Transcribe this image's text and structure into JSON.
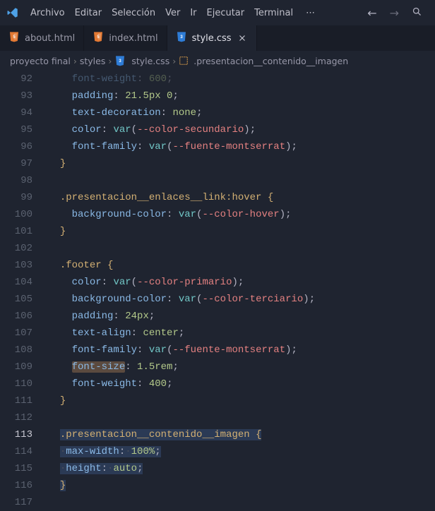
{
  "menu": {
    "items": [
      "Archivo",
      "Editar",
      "Selección",
      "Ver",
      "Ir",
      "Ejecutar",
      "Terminal"
    ],
    "overflow": "⋯"
  },
  "titlebar_nav": {
    "back": "←",
    "forward": "→",
    "search": "search"
  },
  "tabs": [
    {
      "icon": "html",
      "label": "about.html",
      "active": false
    },
    {
      "icon": "html",
      "label": "index.html",
      "active": false
    },
    {
      "icon": "css",
      "label": "style.css",
      "active": true
    }
  ],
  "breadcrumb": {
    "parts": [
      "proyecto final",
      "styles",
      "style.css",
      ".presentacion__contenido__imagen"
    ],
    "separator": "›"
  },
  "lines": [
    {
      "n": 92,
      "indent": 2,
      "segs": [
        {
          "t": "font-weight",
          "c": "prop"
        },
        {
          "t": ": ",
          "c": "punc"
        },
        {
          "t": "600",
          "c": "num"
        },
        {
          "t": ";",
          "c": "punc"
        }
      ],
      "faded": true
    },
    {
      "n": 93,
      "indent": 2,
      "segs": [
        {
          "t": "padding",
          "c": "prop"
        },
        {
          "t": ": ",
          "c": "punc"
        },
        {
          "t": "21.5px 0",
          "c": "num"
        },
        {
          "t": ";",
          "c": "punc"
        }
      ]
    },
    {
      "n": 94,
      "indent": 2,
      "segs": [
        {
          "t": "text-decoration",
          "c": "prop"
        },
        {
          "t": ": ",
          "c": "punc"
        },
        {
          "t": "none",
          "c": "num"
        },
        {
          "t": ";",
          "c": "punc"
        }
      ]
    },
    {
      "n": 95,
      "indent": 2,
      "segs": [
        {
          "t": "color",
          "c": "prop"
        },
        {
          "t": ": ",
          "c": "punc"
        },
        {
          "t": "var",
          "c": "fn"
        },
        {
          "t": "(",
          "c": "punc"
        },
        {
          "t": "--color-secundario",
          "c": "var"
        },
        {
          "t": ")",
          "c": "punc"
        },
        {
          "t": ";",
          "c": "punc"
        }
      ]
    },
    {
      "n": 96,
      "indent": 2,
      "segs": [
        {
          "t": "font-family",
          "c": "prop"
        },
        {
          "t": ": ",
          "c": "punc"
        },
        {
          "t": "var",
          "c": "fn"
        },
        {
          "t": "(",
          "c": "punc"
        },
        {
          "t": "--fuente-montserrat",
          "c": "var"
        },
        {
          "t": ")",
          "c": "punc"
        },
        {
          "t": ";",
          "c": "punc"
        }
      ]
    },
    {
      "n": 97,
      "indent": 1,
      "segs": [
        {
          "t": "}",
          "c": "brace"
        }
      ]
    },
    {
      "n": 98,
      "indent": 0,
      "segs": []
    },
    {
      "n": 99,
      "indent": 1,
      "segs": [
        {
          "t": ".presentacion__enlaces__link:hover ",
          "c": "sel"
        },
        {
          "t": "{",
          "c": "brace"
        }
      ]
    },
    {
      "n": 100,
      "indent": 2,
      "segs": [
        {
          "t": "background-color",
          "c": "prop"
        },
        {
          "t": ": ",
          "c": "punc"
        },
        {
          "t": "var",
          "c": "fn"
        },
        {
          "t": "(",
          "c": "punc"
        },
        {
          "t": "--color-hover",
          "c": "var"
        },
        {
          "t": ")",
          "c": "punc"
        },
        {
          "t": ";",
          "c": "punc"
        }
      ]
    },
    {
      "n": 101,
      "indent": 1,
      "segs": [
        {
          "t": "}",
          "c": "brace"
        }
      ]
    },
    {
      "n": 102,
      "indent": 0,
      "segs": []
    },
    {
      "n": 103,
      "indent": 1,
      "segs": [
        {
          "t": ".footer ",
          "c": "sel"
        },
        {
          "t": "{",
          "c": "brace"
        }
      ]
    },
    {
      "n": 104,
      "indent": 2,
      "segs": [
        {
          "t": "color",
          "c": "prop"
        },
        {
          "t": ": ",
          "c": "punc"
        },
        {
          "t": "var",
          "c": "fn"
        },
        {
          "t": "(",
          "c": "punc"
        },
        {
          "t": "--color-primario",
          "c": "var"
        },
        {
          "t": ")",
          "c": "punc"
        },
        {
          "t": ";",
          "c": "punc"
        }
      ]
    },
    {
      "n": 105,
      "indent": 2,
      "segs": [
        {
          "t": "background-color",
          "c": "prop"
        },
        {
          "t": ": ",
          "c": "punc"
        },
        {
          "t": "var",
          "c": "fn"
        },
        {
          "t": "(",
          "c": "punc"
        },
        {
          "t": "--color-terciario",
          "c": "var"
        },
        {
          "t": ")",
          "c": "punc"
        },
        {
          "t": ";",
          "c": "punc"
        }
      ]
    },
    {
      "n": 106,
      "indent": 2,
      "segs": [
        {
          "t": "padding",
          "c": "prop"
        },
        {
          "t": ": ",
          "c": "punc"
        },
        {
          "t": "24px",
          "c": "num"
        },
        {
          "t": ";",
          "c": "punc"
        }
      ]
    },
    {
      "n": 107,
      "indent": 2,
      "segs": [
        {
          "t": "text-align",
          "c": "prop"
        },
        {
          "t": ": ",
          "c": "punc"
        },
        {
          "t": "center",
          "c": "num"
        },
        {
          "t": ";",
          "c": "punc"
        }
      ]
    },
    {
      "n": 108,
      "indent": 2,
      "segs": [
        {
          "t": "font-family",
          "c": "prop"
        },
        {
          "t": ": ",
          "c": "punc"
        },
        {
          "t": "var",
          "c": "fn"
        },
        {
          "t": "(",
          "c": "punc"
        },
        {
          "t": "--fuente-montserrat",
          "c": "var"
        },
        {
          "t": ")",
          "c": "punc"
        },
        {
          "t": ";",
          "c": "punc"
        }
      ]
    },
    {
      "n": 109,
      "indent": 2,
      "segs": [
        {
          "t": "font-size",
          "c": "prop",
          "hl": true
        },
        {
          "t": ": ",
          "c": "punc"
        },
        {
          "t": "1.5rem",
          "c": "num"
        },
        {
          "t": ";",
          "c": "punc"
        }
      ]
    },
    {
      "n": 110,
      "indent": 2,
      "segs": [
        {
          "t": "font-weight",
          "c": "prop"
        },
        {
          "t": ": ",
          "c": "punc"
        },
        {
          "t": "400",
          "c": "num"
        },
        {
          "t": ";",
          "c": "punc"
        }
      ]
    },
    {
      "n": 111,
      "indent": 1,
      "segs": [
        {
          "t": "}",
          "c": "brace"
        }
      ]
    },
    {
      "n": 112,
      "indent": 0,
      "segs": []
    },
    {
      "n": 113,
      "indent": 1,
      "segs": [
        {
          "t": ".presentacion__contenido__imagen ",
          "c": "sel"
        },
        {
          "t": "{",
          "c": "brace"
        }
      ],
      "selected": true,
      "current": true
    },
    {
      "n": 114,
      "indent": 1,
      "segs": [
        {
          "t": "·",
          "c": "ws"
        },
        {
          "t": "max-width",
          "c": "prop"
        },
        {
          "t": ":",
          "c": "punc"
        },
        {
          "t": "·",
          "c": "ws"
        },
        {
          "t": "100%",
          "c": "num"
        },
        {
          "t": ";",
          "c": "punc"
        }
      ],
      "selected": true,
      "ws": true
    },
    {
      "n": 115,
      "indent": 1,
      "segs": [
        {
          "t": "·",
          "c": "ws"
        },
        {
          "t": "height",
          "c": "prop"
        },
        {
          "t": ":",
          "c": "punc"
        },
        {
          "t": "·",
          "c": "ws"
        },
        {
          "t": "auto",
          "c": "num"
        },
        {
          "t": ";",
          "c": "punc"
        }
      ],
      "selected": true,
      "ws": true
    },
    {
      "n": 116,
      "indent": 1,
      "segs": [
        {
          "t": "}",
          "c": "brace"
        }
      ],
      "selected": true
    },
    {
      "n": 117,
      "indent": 0,
      "segs": []
    }
  ]
}
